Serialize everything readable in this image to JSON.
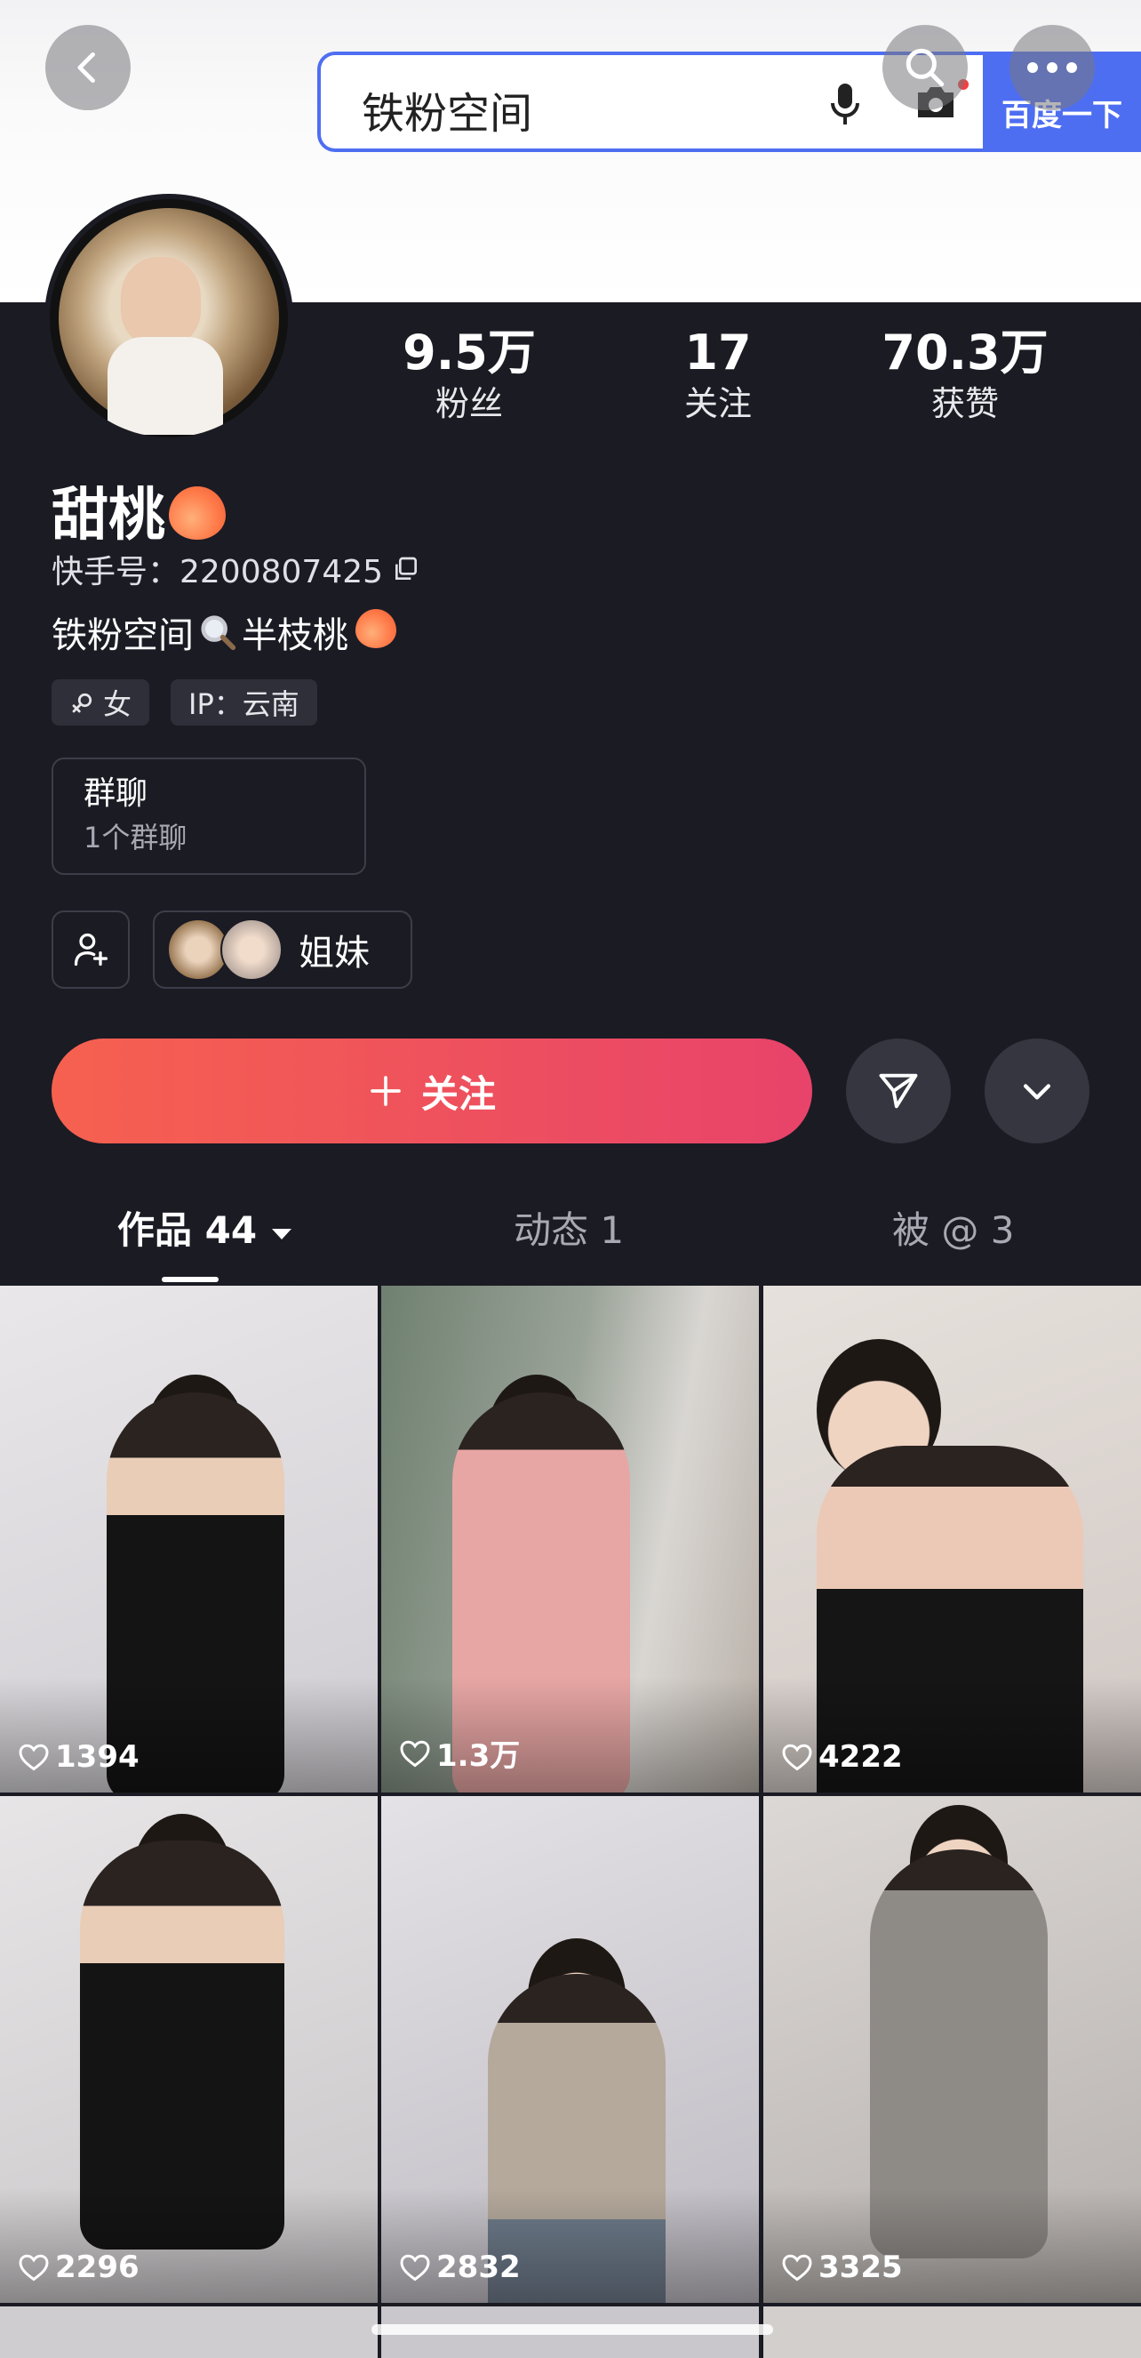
{
  "browser": {
    "search_query": "铁粉空间",
    "search_button": "百度一下"
  },
  "profile": {
    "stats": [
      {
        "value": "9.5万",
        "label": "粉丝"
      },
      {
        "value": "17",
        "label": "关注"
      },
      {
        "value": "70.3万",
        "label": "获赞"
      }
    ],
    "name": "甜桃",
    "kuaishou_id": "快手号：2200807425",
    "bio_part1": "铁粉空间",
    "bio_part2": "半枝桃",
    "tags": [
      "女",
      "IP：云南"
    ],
    "group": {
      "title": "群聊",
      "subtitle": "1个群聊"
    },
    "sisters_label": "姐妹",
    "follow_label": "关注"
  },
  "tabs": [
    {
      "label": "作品 44"
    },
    {
      "label": "动态 1"
    },
    {
      "label": "被 @ 3"
    }
  ],
  "videos": [
    {
      "likes": "1394"
    },
    {
      "likes": "1.3万"
    },
    {
      "likes": "4222"
    },
    {
      "likes": "2296"
    },
    {
      "likes": "2832"
    },
    {
      "likes": "3325"
    }
  ],
  "colors": {
    "background": "#1b1b24",
    "follow_gradient_start": "#f6614f",
    "follow_gradient_end": "#e8436a",
    "search_accent": "#4e6ef2"
  }
}
